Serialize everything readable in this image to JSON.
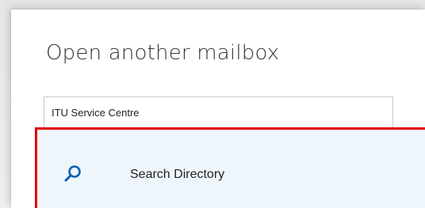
{
  "dialog": {
    "title": "Open another mailbox"
  },
  "mailbox_input": {
    "value": "ITU Service Centre"
  },
  "suggestions": {
    "search_directory_label": "Search Directory",
    "search_icon": "search-icon",
    "highlight_color": "#e00000",
    "row_background": "#eef5fb",
    "icon_color": "#0a62b0"
  }
}
